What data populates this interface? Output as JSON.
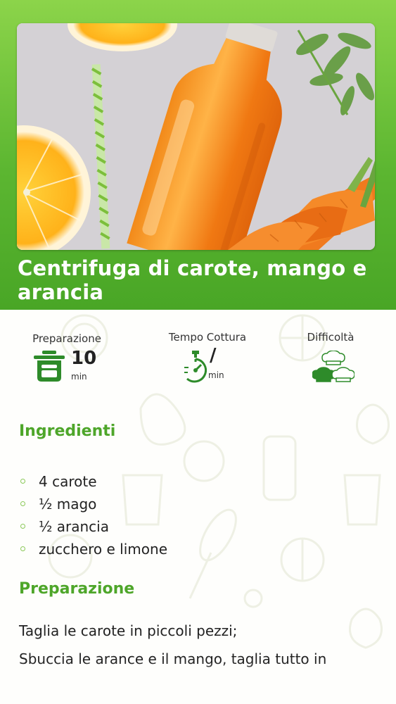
{
  "recipe": {
    "title": "Centrifuga di carote, mango e arancia"
  },
  "stats": {
    "preparation": {
      "label": "Preparazione",
      "value": "10",
      "unit": "min",
      "icon": "pot-icon"
    },
    "cooking": {
      "label": "Tempo Cottura",
      "value": "/",
      "unit": "min",
      "icon": "stopwatch-icon"
    },
    "difficulty": {
      "label": "Difficoltà",
      "level": 1,
      "max": 3,
      "icon": "chef-hat-icon"
    }
  },
  "ingredients": {
    "heading": "Ingredienti",
    "items": [
      "4 carote",
      "½ mago",
      "½ arancia",
      "zucchero e limone"
    ]
  },
  "preparation": {
    "heading": "Preparazione",
    "lines": [
      "Taglia le carote in piccoli pezzi;",
      "Sbuccia le arance e il mango, taglia tutto  in"
    ]
  },
  "colors": {
    "accent": "#4ea62a",
    "header_top": "#8cd44a",
    "header_bottom": "#49a626"
  }
}
